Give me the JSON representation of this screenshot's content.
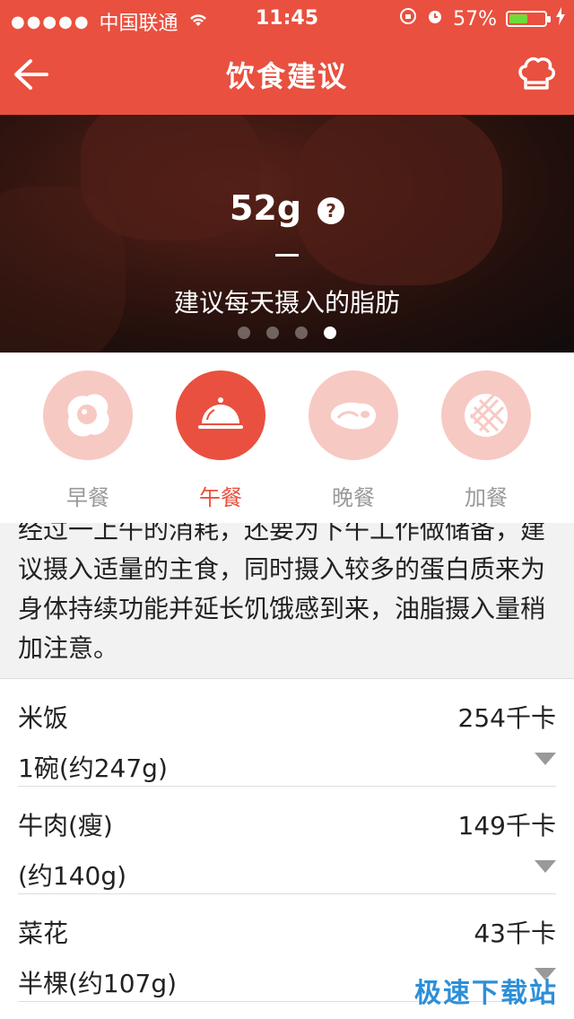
{
  "status": {
    "carrier": "中国联通",
    "time": "11:45",
    "battery": "57%",
    "battery_level": 0.57
  },
  "nav": {
    "title": "饮食建议",
    "back_icon": "arrow-left-icon",
    "right_icon": "chef-hat-icon"
  },
  "hero": {
    "value": "52g",
    "help_glyph": "?",
    "caption": "建议每天摄入的脂肪",
    "page_count": 4,
    "active_page": 4
  },
  "meals": [
    {
      "label": "早餐",
      "icon": "fried-egg-icon",
      "active": false
    },
    {
      "label": "午餐",
      "icon": "food-cloche-icon",
      "active": true
    },
    {
      "label": "晚餐",
      "icon": "steak-icon",
      "active": false
    },
    {
      "label": "加餐",
      "icon": "biscuit-icon",
      "active": false
    }
  ],
  "advice": {
    "text": "经过一上午的消耗，还要为下午工作做储备，建议摄入适量的主食，同时摄入较多的蛋白质来为身体持续功能并延长饥饿感到来，油脂摄入量稍加注意。"
  },
  "foods": [
    {
      "name": "米饭",
      "kcal": "254千卡",
      "portion": "1碗(约247g)"
    },
    {
      "name": "牛肉(瘦)",
      "kcal": "149千卡",
      "portion": "(约140g)"
    },
    {
      "name": "菜花",
      "kcal": "43千卡",
      "portion": "半棵(约107g)"
    }
  ],
  "watermark": "极速下载站",
  "colors": {
    "accent": "#e9503f",
    "inactive_circle": "#f7c9c3",
    "muted_text": "#999999"
  }
}
